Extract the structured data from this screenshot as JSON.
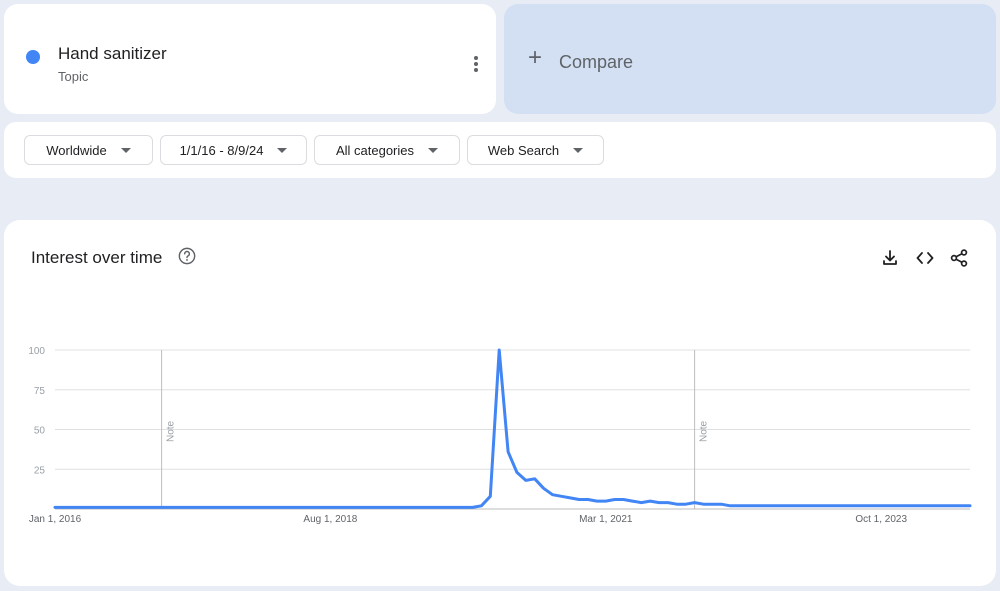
{
  "term": {
    "name": "Hand sanitizer",
    "type": "Topic",
    "color": "#4285f4"
  },
  "compare": {
    "label": "Compare"
  },
  "filters": {
    "region": "Worldwide",
    "date_range": "1/1/16 - 8/9/24",
    "category": "All categories",
    "search_type": "Web Search"
  },
  "chart_section": {
    "title": "Interest over time",
    "icons": [
      "help-icon",
      "download-icon",
      "embed-icon",
      "share-icon"
    ]
  },
  "chart_data": {
    "type": "line",
    "title": "Interest over time",
    "xlabel": "",
    "ylabel": "",
    "ylim": [
      0,
      100
    ],
    "yticks": [
      25,
      50,
      75,
      100
    ],
    "xtick_labels": [
      "Jan 1, 2016",
      "Aug 1, 2018",
      "Mar 1, 2021",
      "Oct 1, 2023"
    ],
    "xlim": [
      "2016-01",
      "2024-08"
    ],
    "grid": true,
    "line_color": "#4285f4",
    "annotations": [
      {
        "x": "2017-01",
        "label": "Note"
      },
      {
        "x": "2022-01",
        "label": "Note"
      }
    ],
    "series": [
      {
        "name": "Hand sanitizer",
        "points": [
          [
            "2016-01",
            1
          ],
          [
            "2017-01",
            1
          ],
          [
            "2018-01",
            1
          ],
          [
            "2019-01",
            1
          ],
          [
            "2019-09",
            1
          ],
          [
            "2019-12",
            1
          ],
          [
            "2020-01",
            2
          ],
          [
            "2020-02",
            8
          ],
          [
            "2020-03",
            100
          ],
          [
            "2020-04",
            36
          ],
          [
            "2020-05",
            23
          ],
          [
            "2020-06",
            18
          ],
          [
            "2020-07",
            19
          ],
          [
            "2020-08",
            13
          ],
          [
            "2020-09",
            9
          ],
          [
            "2020-10",
            8
          ],
          [
            "2020-11",
            7
          ],
          [
            "2020-12",
            6
          ],
          [
            "2021-01",
            6
          ],
          [
            "2021-02",
            5
          ],
          [
            "2021-03",
            5
          ],
          [
            "2021-04",
            6
          ],
          [
            "2021-05",
            6
          ],
          [
            "2021-06",
            5
          ],
          [
            "2021-07",
            4
          ],
          [
            "2021-08",
            5
          ],
          [
            "2021-09",
            4
          ],
          [
            "2021-10",
            4
          ],
          [
            "2021-11",
            3
          ],
          [
            "2021-12",
            3
          ],
          [
            "2022-01",
            4
          ],
          [
            "2022-02",
            3
          ],
          [
            "2022-03",
            3
          ],
          [
            "2022-04",
            3
          ],
          [
            "2022-05",
            2
          ],
          [
            "2022-06",
            2
          ],
          [
            "2022-09",
            2
          ],
          [
            "2023-01",
            2
          ],
          [
            "2023-06",
            2
          ],
          [
            "2024-01",
            2
          ],
          [
            "2024-08",
            2
          ]
        ]
      }
    ]
  }
}
